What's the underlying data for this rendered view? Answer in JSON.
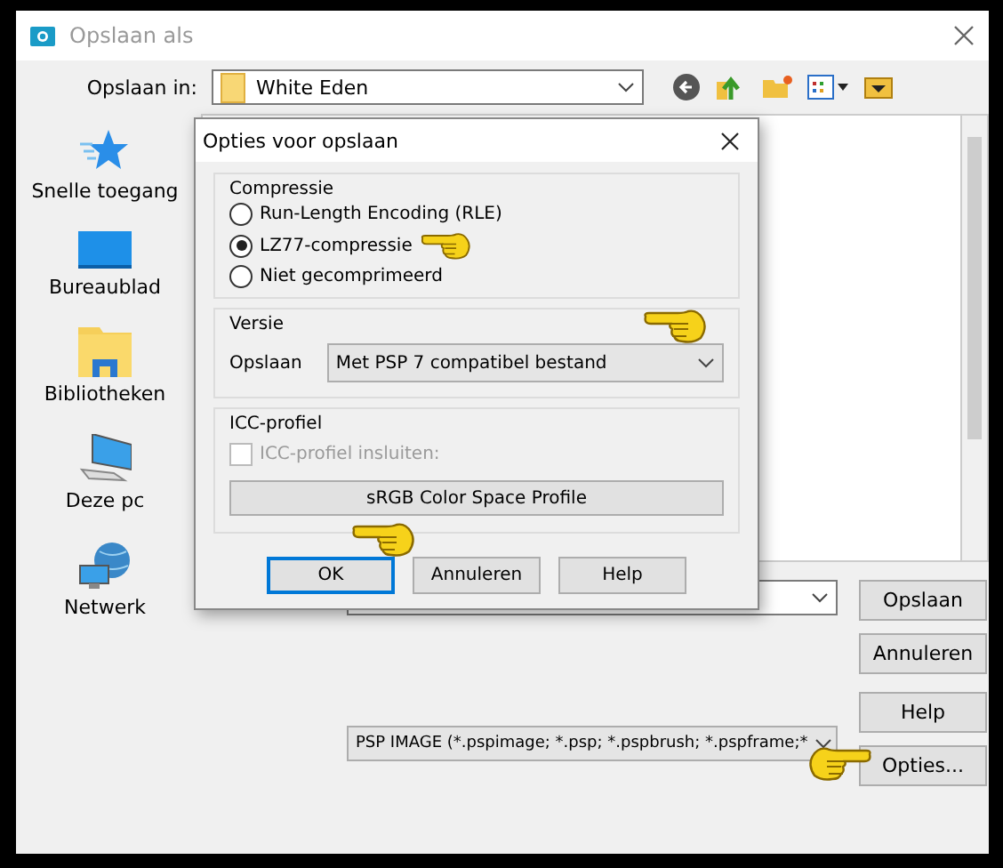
{
  "window": {
    "title": "Opslaan als"
  },
  "location": {
    "label": "Opslaan in:",
    "value": "White Eden"
  },
  "places": [
    {
      "label": "Snelle toegang",
      "kind": "star"
    },
    {
      "label": "Bureaublad",
      "kind": "desktop"
    },
    {
      "label": "Bibliotheken",
      "kind": "library"
    },
    {
      "label": "Deze pc",
      "kind": "pc"
    },
    {
      "label": "Netwerk",
      "kind": "network"
    }
  ],
  "file_type": {
    "value": "PSP IMAGE (*.pspimage; *.psp; *.pspbrush; *.pspframe;*"
  },
  "buttons": [
    {
      "label": "Opslaan"
    },
    {
      "label": "Annuleren"
    },
    {
      "label": "Help"
    },
    {
      "label": "Opties..."
    }
  ],
  "dialog": {
    "title": "Opties voor opslaan",
    "compression": {
      "title": "Compressie",
      "options": [
        {
          "label": "Run-Length Encoding (RLE)",
          "selected": false
        },
        {
          "label": "LZ77-compressie",
          "selected": true
        },
        {
          "label": "Niet gecomprimeerd",
          "selected": false
        }
      ]
    },
    "version": {
      "title": "Versie",
      "label": "Opslaan",
      "value": "Met PSP 7 compatibel bestand"
    },
    "icc": {
      "title": "ICC-profiel",
      "checkbox": {
        "label": "ICC-profiel insluiten:",
        "checked": false,
        "disabled": true
      },
      "button": "sRGB Color Space Profile"
    },
    "buttons": [
      {
        "label": "OK",
        "default": true
      },
      {
        "label": "Annuleren",
        "default": false
      },
      {
        "label": "Help",
        "default": false
      }
    ]
  }
}
